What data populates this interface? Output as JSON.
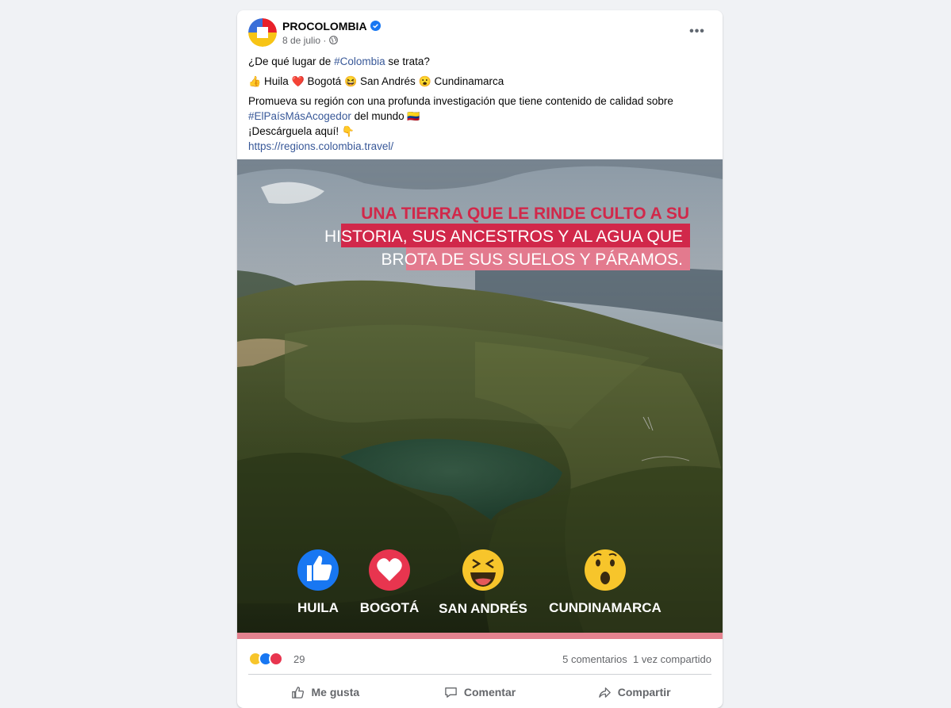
{
  "post": {
    "page_name": "PROCOLOMBIA",
    "date": "8 de julio",
    "meta_separator": "·",
    "more_label": "•••",
    "text": {
      "line1_pre": "¿De qué lugar de ",
      "line1_tag": "#Colombia",
      "line1_post": " se trata?",
      "options": [
        {
          "emoji": "👍",
          "label": "Huila"
        },
        {
          "emoji": "❤️",
          "label": "Bogotá"
        },
        {
          "emoji": "😆",
          "label": "San Andrés"
        },
        {
          "emoji": "😮",
          "label": "Cundinamarca"
        }
      ],
      "line3_pre": "Promueva su región con una profunda investigación que tiene contenido de calidad sobre",
      "line3_tag": "#ElPaísMásAcogedor",
      "line3_post": " del mundo ",
      "flag_emoji": "🇨🇴",
      "line4": "¡Descárguela aquí! ",
      "point_emoji": "👇",
      "url": "https://regions.colombia.travel/"
    },
    "image": {
      "headline_line1": "UNA TIERRA QUE LE RINDE CULTO A SU",
      "headline_line2": "HISTORIA, SUS ANCESTROS Y AL AGUA QUE",
      "headline_line3": "BROTA DE SUS SUELOS Y PÁRAMOS.",
      "reactions": [
        {
          "icon": "like-icon",
          "label": "HUILA"
        },
        {
          "icon": "love-icon",
          "label": "BOGOTÁ"
        },
        {
          "icon": "haha-icon",
          "label": "SAN ANDRÉS"
        },
        {
          "icon": "wow-icon",
          "label": "CUNDINAMARCA"
        }
      ]
    },
    "reaction_count": "29",
    "comments": "5 comentarios",
    "shares": "1 vez compartido",
    "actions": {
      "like": "Me gusta",
      "comment": "Comentar",
      "share": "Compartir"
    },
    "colors": {
      "link": "#385898",
      "brand_red": "#d1284a",
      "like_blue": "#1877f2"
    }
  }
}
